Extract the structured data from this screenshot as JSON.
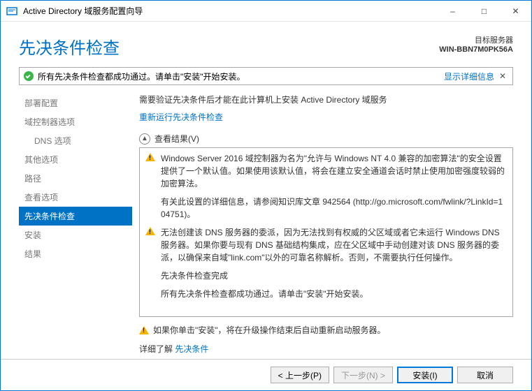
{
  "window": {
    "title": "Active Directory 域服务配置向导"
  },
  "header": {
    "pageTitle": "先决条件检查",
    "targetLabel": "目标服务器",
    "targetServer": "WIN-BBN7M0PK56A"
  },
  "banner": {
    "text": "所有先决条件检查都成功通过。请单击\"安装\"开始安装。",
    "link": "显示详细信息"
  },
  "sidebar": {
    "items": [
      {
        "label": "部署配置",
        "indent": false
      },
      {
        "label": "域控制器选项",
        "indent": false
      },
      {
        "label": "DNS 选项",
        "indent": true
      },
      {
        "label": "其他选项",
        "indent": false
      },
      {
        "label": "路径",
        "indent": false
      },
      {
        "label": "查看选项",
        "indent": false
      },
      {
        "label": "先决条件检查",
        "indent": false,
        "active": true
      },
      {
        "label": "安装",
        "indent": false
      },
      {
        "label": "结果",
        "indent": false
      }
    ]
  },
  "main": {
    "desc": "需要验证先决条件后才能在此计算机上安装 Active Directory 域服务",
    "rerunLink": "重新运行先决条件检查",
    "resultsHeader": "查看结果(V)",
    "results": [
      {
        "icon": "warn",
        "text": "Windows Server 2016 域控制器为名为\"允许与 Windows NT 4.0 兼容的加密算法\"的安全设置提供了一个默认值。如果使用该默认值，将会在建立安全通道会话时禁止使用加密强度较弱的加密算法。"
      },
      {
        "icon": "none",
        "text": "有关此设置的详细信息，请参阅知识库文章 942564 (http://go.microsoft.com/fwlink/?LinkId=104751)。"
      },
      {
        "icon": "warn",
        "text": "无法创建该 DNS 服务器的委派，因为无法找到有权威的父区域或者它未运行 Windows DNS 服务器。如果你要与现有 DNS 基础结构集成，应在父区域中手动创建对该 DNS 服务器的委派，以确保来自域\"link.com\"以外的可靠名称解析。否则，不需要执行任何操作。"
      },
      {
        "icon": "ok",
        "text": "先决条件检查完成"
      },
      {
        "icon": "ok",
        "text": "所有先决条件检查都成功通过。请单击\"安装\"开始安装。"
      }
    ],
    "footerNote": "如果你单击\"安装\"，将在升级操作结束后自动重新启动服务器。",
    "learnPrefix": "详细了解 ",
    "learnLink": "先决条件"
  },
  "buttons": {
    "prev": "< 上一步(P)",
    "next": "下一步(N) >",
    "install": "安装(I)",
    "cancel": "取消"
  }
}
